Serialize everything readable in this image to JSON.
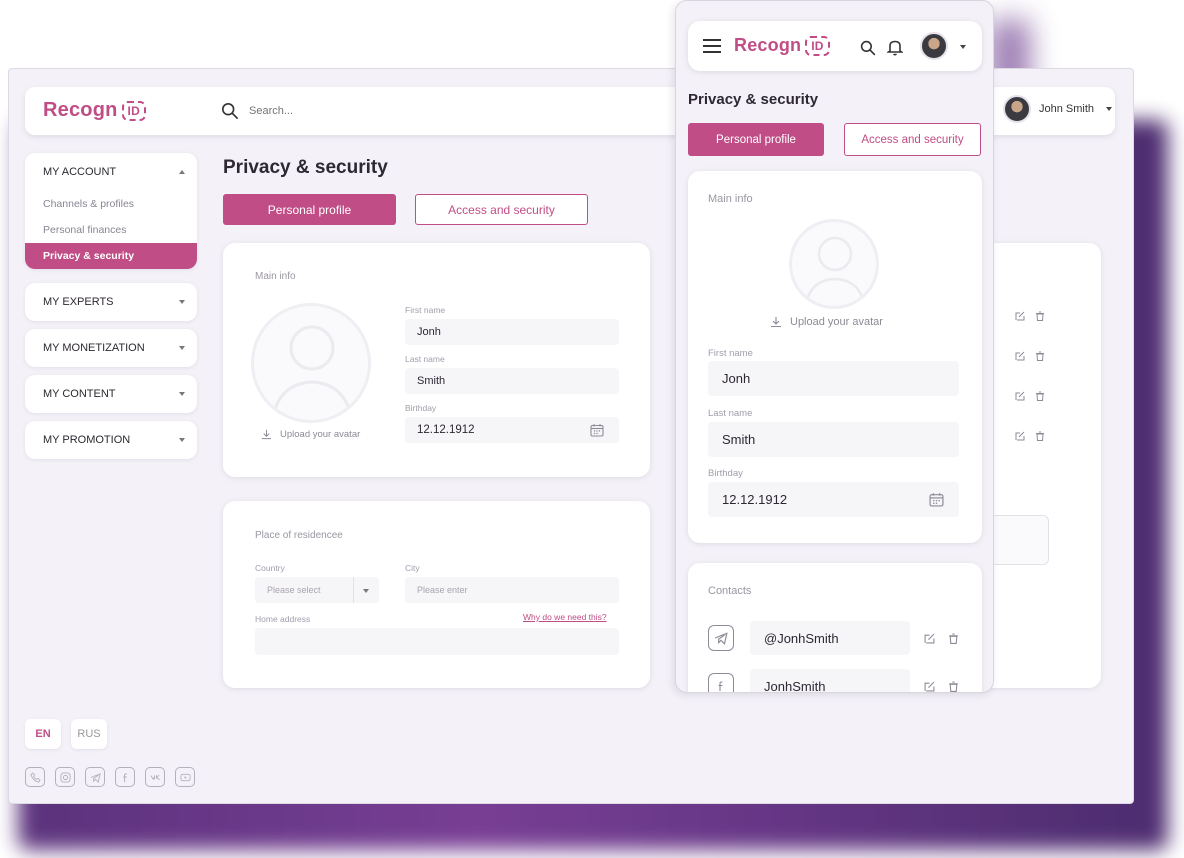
{
  "brand": {
    "name": "Recogn",
    "badge": "ID",
    "accent": "#c04d86"
  },
  "desktop": {
    "search_placeholder": "Search...",
    "user_name": "John Smith",
    "sidebar": {
      "account": {
        "label": "MY ACCOUNT",
        "items": [
          "Channels & profiles",
          "Personal finances",
          "Privacy & security"
        ],
        "active": "Privacy & security"
      },
      "sections": [
        "MY EXPERTS",
        "MY MONETIZATION",
        "MY CONTENT",
        "MY PROMOTION"
      ]
    },
    "languages": [
      "EN",
      "RUS"
    ],
    "active_language": "EN",
    "social_icons": [
      "phone-icon",
      "instagram-icon",
      "telegram-icon",
      "facebook-icon",
      "vk-icon",
      "youtube-icon"
    ],
    "page_title": "Privacy & security",
    "tabs": {
      "primary": "Personal profile",
      "secondary": "Access and security"
    },
    "main_info": {
      "title": "Main info",
      "upload_label": "Upload your avatar",
      "first_name_label": "First name",
      "first_name": "Jonh",
      "last_name_label": "Last name",
      "last_name": "Smith",
      "birthday_label": "Birthday",
      "birthday": "12.12.1912"
    },
    "residence": {
      "title": "Place of residencee",
      "country_label": "Country",
      "country_placeholder": "Please select",
      "city_label": "City",
      "city_placeholder": "Please enter",
      "address_label": "Home address",
      "why_link": "Why do we need this?"
    }
  },
  "mobile": {
    "page_title": "Privacy & security",
    "tabs": {
      "primary": "Personal profile",
      "secondary": "Access and security"
    },
    "main_info": {
      "title": "Main info",
      "upload_label": "Upload your avatar",
      "first_name_label": "First name",
      "first_name": "Jonh",
      "last_name_label": "Last name",
      "last_name": "Smith",
      "birthday_label": "Birthday",
      "birthday": "12.12.1912"
    },
    "contacts": {
      "title": "Contacts",
      "items": [
        {
          "icon": "telegram-icon",
          "value": "@JonhSmith"
        },
        {
          "icon": "facebook-icon",
          "value": "JonhSmith"
        }
      ]
    }
  }
}
